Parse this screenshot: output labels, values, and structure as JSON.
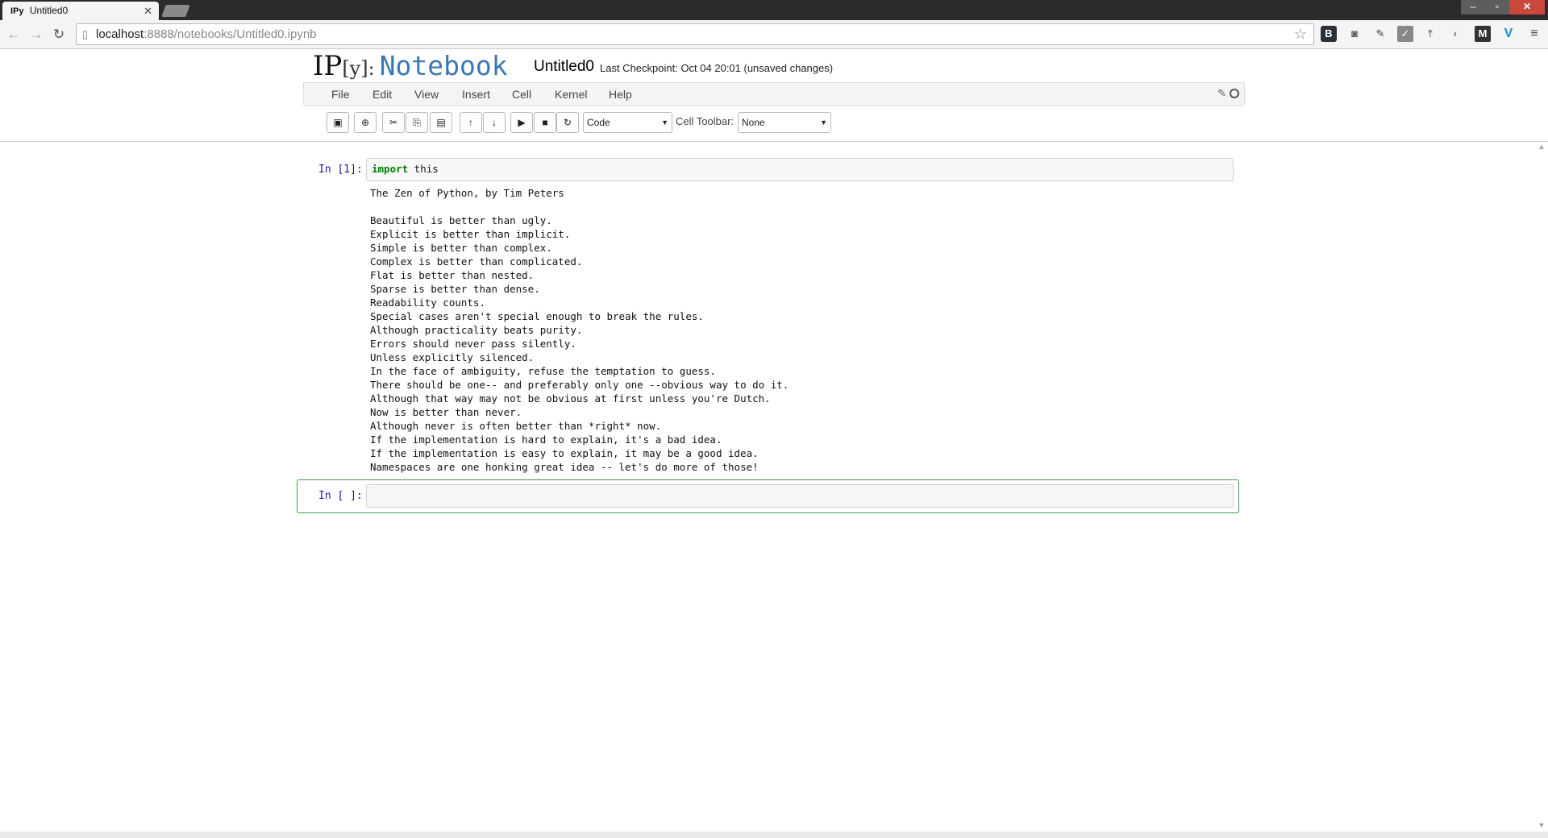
{
  "browser": {
    "tab_title": "Untitled0",
    "tab_favicon": "IPy",
    "url_host": "localhost",
    "url_rest": ":8888/notebooks/Untitled0.ipynb",
    "icons": [
      "back-icon",
      "forward-icon",
      "reload-icon",
      "star-icon",
      "menu-icon"
    ]
  },
  "notebook": {
    "logo_ip": "IP",
    "logo_y": "[y]:",
    "logo_notebook": "Notebook",
    "name": "Untitled0",
    "checkpoint": "Last Checkpoint: Oct 04 20:01 (unsaved changes)",
    "brand_color": "#3a78b5"
  },
  "menu": {
    "file": "File",
    "edit": "Edit",
    "view": "View",
    "insert": "Insert",
    "cell": "Cell",
    "kernel": "Kernel",
    "help": "Help"
  },
  "toolbar": {
    "cell_type": "Code",
    "cell_toolbar_label": "Cell Toolbar:",
    "cell_toolbar_value": "None"
  },
  "cells": [
    {
      "prompt": "In [1]:",
      "code_keyword": "import",
      "code_rest": " this",
      "output": [
        "The Zen of Python, by Tim Peters",
        "",
        "Beautiful is better than ugly.",
        "Explicit is better than implicit.",
        "Simple is better than complex.",
        "Complex is better than complicated.",
        "Flat is better than nested.",
        "Sparse is better than dense.",
        "Readability counts.",
        "Special cases aren't special enough to break the rules.",
        "Although practicality beats purity.",
        "Errors should never pass silently.",
        "Unless explicitly silenced.",
        "In the face of ambiguity, refuse the temptation to guess.",
        "There should be one-- and preferably only one --obvious way to do it.",
        "Although that way may not be obvious at first unless you're Dutch.",
        "Now is better than never.",
        "Although never is often better than *right* now.",
        "If the implementation is hard to explain, it's a bad idea.",
        "If the implementation is easy to explain, it may be a good idea.",
        "Namespaces are one honking great idea -- let's do more of those!"
      ]
    },
    {
      "prompt": "In [ ]:",
      "code": ""
    }
  ]
}
